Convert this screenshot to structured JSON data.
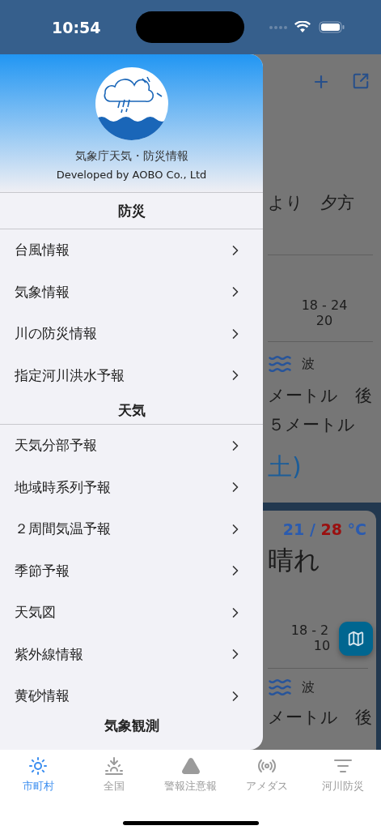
{
  "status_bar": {
    "time": "10:54"
  },
  "drawer": {
    "app_name": "気象庁天気・防災情報",
    "developer": "Developed by AOBO Co., Ltd",
    "sections": [
      {
        "title": "防災",
        "items": [
          "台風情報",
          "気象情報",
          "川の防災情報",
          "指定河川洪水予報"
        ]
      },
      {
        "title": "天気",
        "items": [
          "天気分部予報",
          "地域時系列予報",
          "２周間気温予報",
          "季節予報",
          "天気図",
          "紫外線情報",
          "黄砂情報"
        ]
      },
      {
        "title": "気象観測"
      }
    ]
  },
  "background": {
    "forecast_text": "より　夕方",
    "temp_range": "18 - 24",
    "value": "20",
    "wave_label": "波",
    "wave_text_1": "メートル　後",
    "wave_text_2": "５メートル",
    "date": "土)",
    "card": {
      "low": "21",
      "separator": "/",
      "high": "28",
      "unit": "°C",
      "weather": "晴れ",
      "temp_range": "18 - 2",
      "value": "10",
      "wave_label": "波",
      "wave_text": "メートル　後"
    }
  },
  "tabs": [
    {
      "label": "市町村",
      "selected": true
    },
    {
      "label": "全国",
      "selected": false
    },
    {
      "label": "警報注意報",
      "selected": false
    },
    {
      "label": "アメダス",
      "selected": false
    },
    {
      "label": "河川防災",
      "selected": false
    }
  ]
}
